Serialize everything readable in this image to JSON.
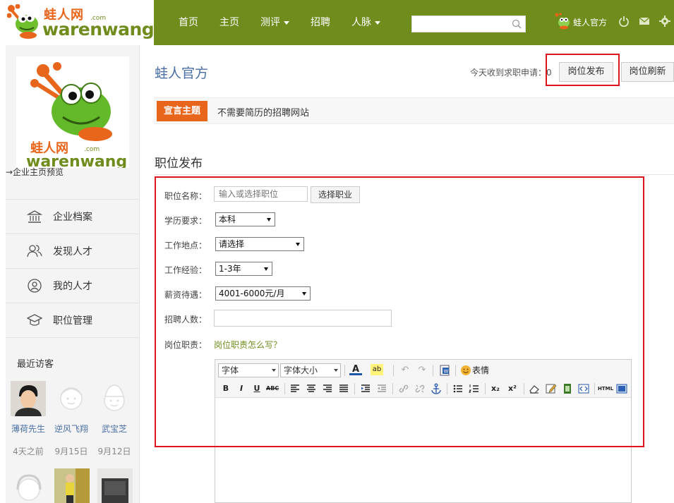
{
  "header": {
    "logo": {
      "cn": "蛙人网",
      "com": ".com",
      "en": "warenwang"
    },
    "nav": [
      {
        "label": "首页",
        "dropdown": false
      },
      {
        "label": "主页",
        "dropdown": false
      },
      {
        "label": "测评",
        "dropdown": true
      },
      {
        "label": "招聘",
        "dropdown": false
      },
      {
        "label": "人脉",
        "dropdown": true
      }
    ],
    "search": {
      "value": "",
      "placeholder": ""
    },
    "user_name": "蛙人官方",
    "icons": [
      "power-icon",
      "mail-icon",
      "gear-icon"
    ],
    "brand_color": "#6f8c1d",
    "accent_color": "#e8651c"
  },
  "sidebar": {
    "preview_link": "→企业主页预览",
    "menu": [
      {
        "label": "企业档案",
        "icon": "bank-icon"
      },
      {
        "label": "发现人才",
        "icon": "people-icon"
      },
      {
        "label": "我的人才",
        "icon": "person-icon"
      },
      {
        "label": "职位管理",
        "icon": "graduation-cap-icon"
      }
    ],
    "visitors_title": "最近访客",
    "visitors": [
      {
        "name": "薄荷先生",
        "date": "4天之前"
      },
      {
        "name": "逆风飞翔",
        "date": "9月15日"
      },
      {
        "name": "武宝芝",
        "date": "9月12日"
      }
    ]
  },
  "main": {
    "title": "蛙人官方",
    "applications_text": "今天收到求职申请：0",
    "publish_button": "岗位发布",
    "refresh_button": "岗位刷新",
    "slogan_tag": "宣言主题",
    "slogan_text": "不需要简历的招聘网站",
    "section_title": "职位发布"
  },
  "form": {
    "position_label": "职位名称：",
    "position_placeholder": "输入或选择职位",
    "choose_button": "选择职业",
    "education_label": "学历要求：",
    "education_value": "本科",
    "location_label": "工作地点：",
    "location_value": "请选择",
    "experience_label": "工作经验：",
    "experience_value": "1-3年",
    "salary_label": "薪资待遇：",
    "salary_value": "4001-6000元/月",
    "count_label": "招聘人数：",
    "count_value": "",
    "duty_label": "岗位职责：",
    "duty_help": "岗位职责怎么写？"
  },
  "editor": {
    "font_label": "字体",
    "size_label": "字体大小",
    "emoji_label": "表情",
    "bold": "B",
    "italic": "I",
    "underline": "U",
    "strikethrough": "ABC",
    "subscript": "x₂",
    "superscript": "x²",
    "html_label": "HTML"
  }
}
